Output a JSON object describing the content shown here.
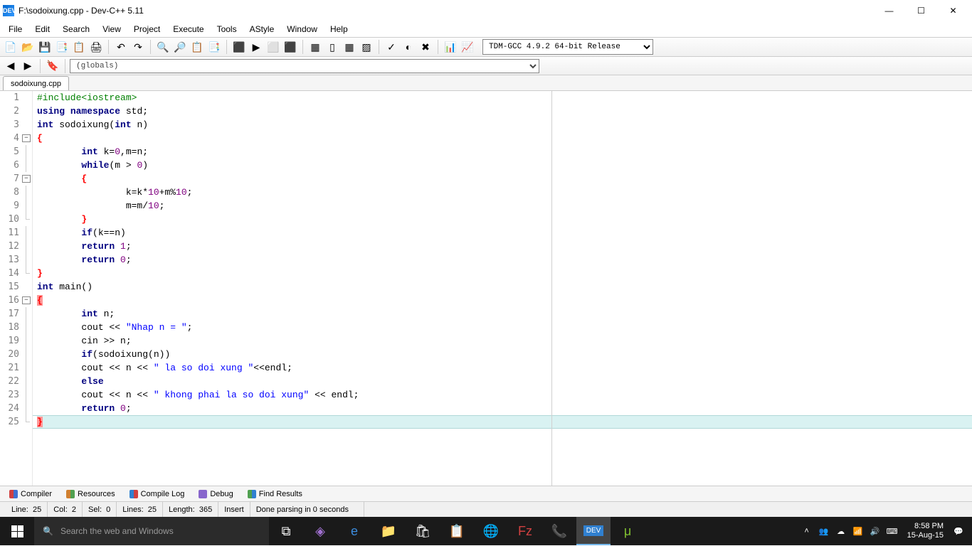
{
  "window": {
    "title": "F:\\sodoixung.cpp - Dev-C++ 5.11",
    "minimize": "—",
    "maximize": "☐",
    "close": "✕"
  },
  "menu": [
    "File",
    "Edit",
    "Search",
    "View",
    "Project",
    "Execute",
    "Tools",
    "AStyle",
    "Window",
    "Help"
  ],
  "compiler_select": "TDM-GCC 4.9.2 64-bit Release",
  "globals_select": "(globals)",
  "tab": "sodoixung.cpp",
  "code_lines": [
    {
      "n": 1,
      "fold": "",
      "html": "<span class='preprocessor'>#include&lt;iostream&gt;</span>"
    },
    {
      "n": 2,
      "fold": "",
      "html": "<span class='keyword'>using</span> <span class='keyword'>namespace</span> std;"
    },
    {
      "n": 3,
      "fold": "",
      "html": "<span class='keyword'>int</span> sodoixung(<span class='keyword'>int</span> n)"
    },
    {
      "n": 4,
      "fold": "box",
      "html": "<span class='brace-red'>{</span>"
    },
    {
      "n": 5,
      "fold": "line",
      "html": "        <span class='keyword'>int</span> k=<span class='num'>0</span>,m=n;"
    },
    {
      "n": 6,
      "fold": "line",
      "html": "        <span class='keyword'>while</span>(m &gt; <span class='num'>0</span>)"
    },
    {
      "n": 7,
      "fold": "box",
      "html": "        <span class='brace-red'>{</span>"
    },
    {
      "n": 8,
      "fold": "line",
      "html": "                k=k*<span class='num'>10</span>+m%<span class='num'>10</span>;"
    },
    {
      "n": 9,
      "fold": "line",
      "html": "                m=m/<span class='num'>10</span>;"
    },
    {
      "n": 10,
      "fold": "end",
      "html": "        <span class='brace-red'>}</span>"
    },
    {
      "n": 11,
      "fold": "line",
      "html": "        <span class='keyword'>if</span>(k==n)"
    },
    {
      "n": 12,
      "fold": "line",
      "html": "        <span class='keyword'>return</span> <span class='num'>1</span>;"
    },
    {
      "n": 13,
      "fold": "line",
      "html": "        <span class='keyword'>return</span> <span class='num'>0</span>;"
    },
    {
      "n": 14,
      "fold": "end",
      "html": "<span class='brace-red'>}</span>"
    },
    {
      "n": 15,
      "fold": "",
      "html": "<span class='keyword'>int</span> main()"
    },
    {
      "n": 16,
      "fold": "box",
      "html": "<span class='brace-red-hl'>{</span>"
    },
    {
      "n": 17,
      "fold": "line",
      "html": "        <span class='keyword'>int</span> n;"
    },
    {
      "n": 18,
      "fold": "line",
      "html": "        cout &lt;&lt; <span class='str'>\"Nhap n = \"</span>;"
    },
    {
      "n": 19,
      "fold": "line",
      "html": "        cin &gt;&gt; n;"
    },
    {
      "n": 20,
      "fold": "line",
      "html": "        <span class='keyword'>if</span>(sodoixung(n))"
    },
    {
      "n": 21,
      "fold": "line",
      "html": "        cout &lt;&lt; n &lt;&lt; <span class='str'>\" la so doi xung \"</span>&lt;&lt;endl;"
    },
    {
      "n": 22,
      "fold": "line",
      "html": "        <span class='keyword'>else</span>"
    },
    {
      "n": 23,
      "fold": "line",
      "html": "        cout &lt;&lt; n &lt;&lt; <span class='str'>\" khong phai la so doi xung\"</span> &lt;&lt; endl;"
    },
    {
      "n": 24,
      "fold": "line",
      "html": "        <span class='keyword'>return</span> <span class='num'>0</span>;"
    },
    {
      "n": 25,
      "fold": "end",
      "html": "<span class='brace-red-hl'>}</span>",
      "hl": true
    }
  ],
  "bottom_tabs": [
    {
      "icon": "#d04040,#4070d0",
      "label": "Compiler"
    },
    {
      "icon": "#d08030,#50a050",
      "label": "Resources"
    },
    {
      "icon": "#3080d0,#d04040",
      "label": "Compile Log"
    },
    {
      "icon": "#8866cc,#8866cc",
      "label": "Debug"
    },
    {
      "icon": "#50a050,#3080d0",
      "label": "Find Results"
    }
  ],
  "status": {
    "line_label": "Line:",
    "line": "25",
    "col_label": "Col:",
    "col": "2",
    "sel_label": "Sel:",
    "sel": "0",
    "lines_label": "Lines:",
    "lines": "25",
    "length_label": "Length:",
    "length": "365",
    "mode": "Insert",
    "msg": "Done parsing in 0 seconds"
  },
  "taskbar": {
    "search_placeholder": "Search the web and Windows",
    "time": "8:58 PM",
    "date": "15-Aug-15"
  }
}
